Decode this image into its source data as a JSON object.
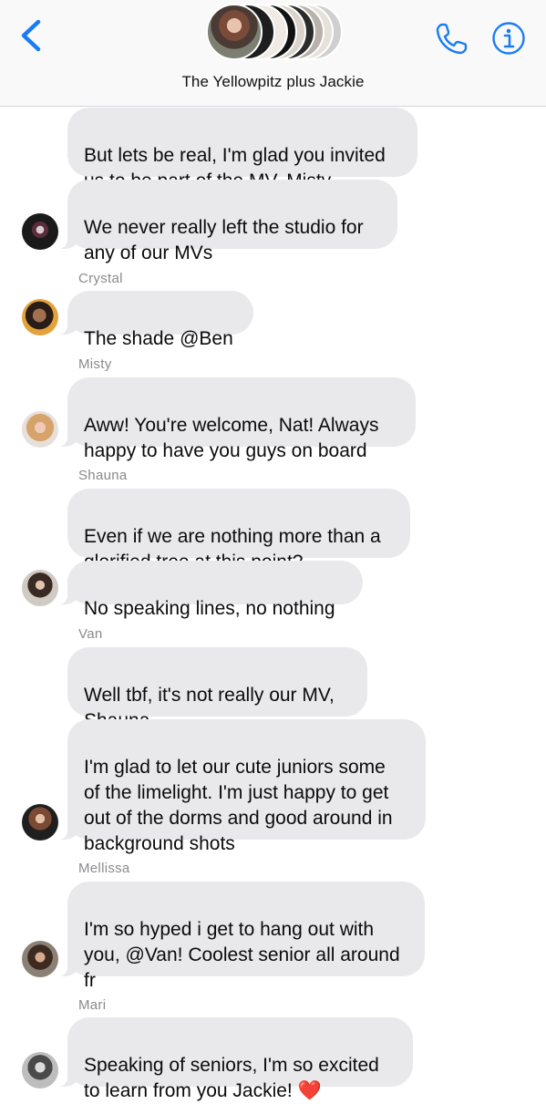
{
  "header": {
    "title": "The Yellowpitz plus Jackie",
    "back_icon": "chevron-left-icon",
    "phone_icon": "phone-icon",
    "info_icon": "info-icon",
    "accent_color": "#1a7cf5"
  },
  "messages": [
    {
      "sender": "",
      "text": "But lets be real, I'm glad you invited\nus to be part of the MV, Misty"
    },
    {
      "sender": "",
      "text": "We never really left the studio for\nany of our MVs"
    },
    {
      "sender": "Crystal",
      "text": "The shade @Ben"
    },
    {
      "sender": "Misty",
      "text": "Aww! You're welcome, Nat! Always\nhappy to have you guys on board"
    },
    {
      "sender": "Shauna",
      "text": "Even if we are nothing more than a\nglorified tree at this point?"
    },
    {
      "sender": "",
      "text": "No speaking lines, no nothing"
    },
    {
      "sender": "Van",
      "text": "Well tbf, it's not really our MV,\nShauna"
    },
    {
      "sender": "",
      "text": "I'm glad to let our cute juniors some\nof the limelight. I'm just happy to get\nout of the dorms and good around in\nbackground shots"
    },
    {
      "sender": "Mellissa",
      "text": "I'm so hyped i get to hang out with\nyou, @Van! Coolest senior all around\nfr"
    },
    {
      "sender": "Mari",
      "text": "Speaking of seniors, I'm so excited\nto learn from you Jackie! ",
      "emoji": "❤️"
    }
  ],
  "colors": {
    "bubble": "#e9e9eb",
    "sender_name": "#8a8a8e",
    "heart": "#e0245e"
  }
}
